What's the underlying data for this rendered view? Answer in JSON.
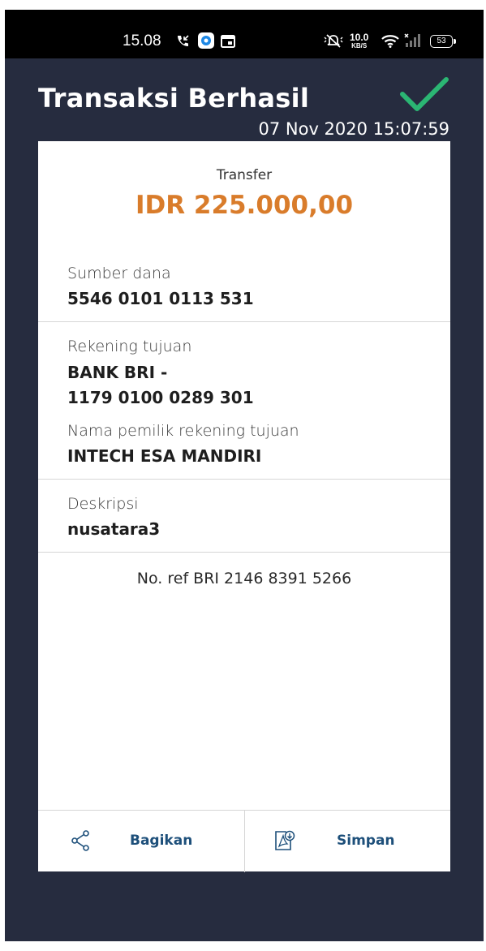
{
  "status_bar": {
    "time": "15.08",
    "network_speed_value": "10.0",
    "network_speed_unit": "KB/S",
    "battery": "53",
    "icons": [
      "missed-call-icon",
      "app-notification-icon",
      "calendar-icon",
      "mute-icon",
      "wifi-icon",
      "signal-icon",
      "battery-icon"
    ]
  },
  "header": {
    "title": "Transaksi Berhasil",
    "status_icon": "checkmark-icon",
    "datetime": "07 Nov 2020 15:07:59"
  },
  "receipt": {
    "transaction_type": "Transfer",
    "amount": "IDR 225.000,00",
    "source_label": "Sumber dana",
    "source_value": "5546 0101 0113 531",
    "destination_label": "Rekening tujuan",
    "destination_bank": "BANK BRI -",
    "destination_account": "1179 0100 0289 301",
    "owner_label": "Nama pemilik rekening tujuan",
    "owner_value": "INTECH ESA MANDIRI",
    "description_label": "Deskripsi",
    "description_value": "nusatara3",
    "reference": "No. ref BRI 2146 8391 5266"
  },
  "actions": {
    "share_label": "Bagikan",
    "save_label": "Simpan"
  },
  "colors": {
    "background": "#262c3f",
    "amount": "#d97c2b",
    "check": "#2bb673",
    "action_text": "#1d4f7a"
  }
}
